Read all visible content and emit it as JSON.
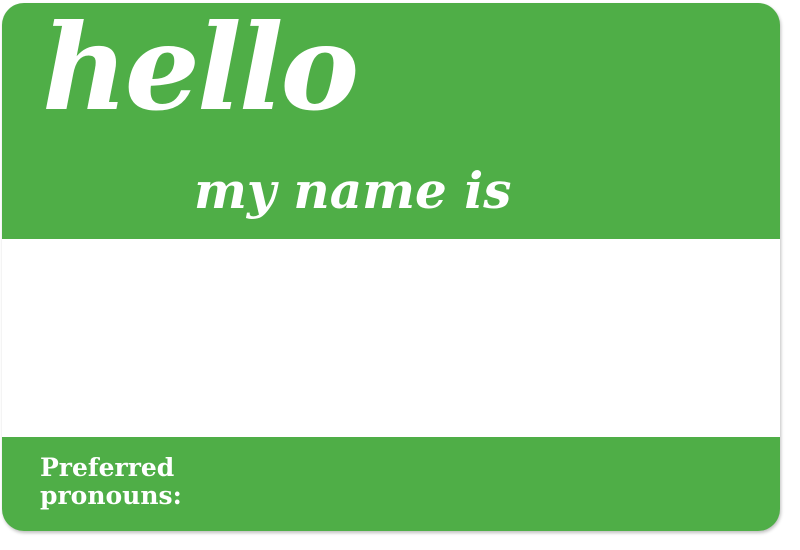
{
  "tag": {
    "greeting": "hello",
    "subtitle": "my name is",
    "name": "",
    "pronouns_label_line1": "Preferred",
    "pronouns_label_line2": "pronouns:",
    "pronouns_value": ""
  },
  "colors": {
    "tag_green": "#4fae47",
    "write_area": "#ffffff",
    "text": "#ffffff"
  }
}
